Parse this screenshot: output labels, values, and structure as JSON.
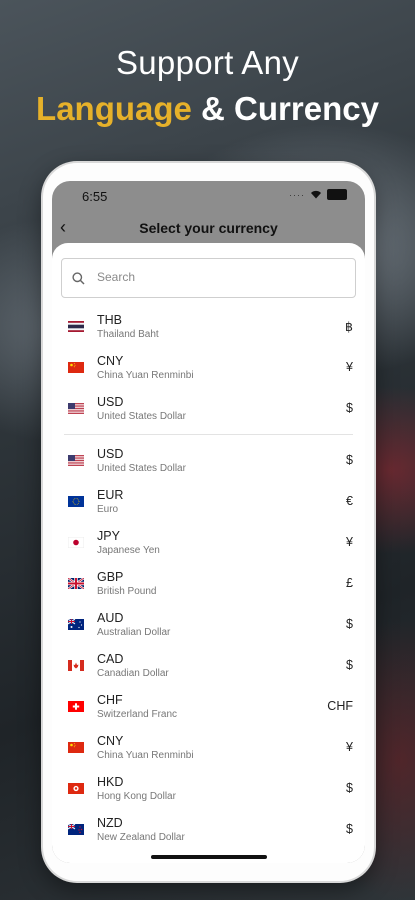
{
  "headline": {
    "line1": "Support Any",
    "line2_highlight": "Language",
    "line2_rest": " & Currency",
    "highlight_color": "#e6b12a"
  },
  "status_bar": {
    "time": "6:55"
  },
  "nav": {
    "title": "Select your currency",
    "back_icon": "chevron-left-icon"
  },
  "search": {
    "placeholder": "Search",
    "value": ""
  },
  "recent": [
    {
      "code": "THB",
      "name": "Thailand Baht",
      "symbol": "฿",
      "flag": "th"
    },
    {
      "code": "CNY",
      "name": "China Yuan Renminbi",
      "symbol": "¥",
      "flag": "cn"
    },
    {
      "code": "USD",
      "name": "United States Dollar",
      "symbol": "$",
      "flag": "us"
    }
  ],
  "currencies": [
    {
      "code": "USD",
      "name": "United States Dollar",
      "symbol": "$",
      "flag": "us"
    },
    {
      "code": "EUR",
      "name": "Euro",
      "symbol": "€",
      "flag": "eu"
    },
    {
      "code": "JPY",
      "name": "Japanese Yen",
      "symbol": "¥",
      "flag": "jp"
    },
    {
      "code": "GBP",
      "name": "British Pound",
      "symbol": "£",
      "flag": "gb"
    },
    {
      "code": "AUD",
      "name": "Australian Dollar",
      "symbol": "$",
      "flag": "au"
    },
    {
      "code": "CAD",
      "name": "Canadian Dollar",
      "symbol": "$",
      "flag": "ca"
    },
    {
      "code": "CHF",
      "name": "Switzerland Franc",
      "symbol": "CHF",
      "flag": "ch"
    },
    {
      "code": "CNY",
      "name": "China Yuan Renminbi",
      "symbol": "¥",
      "flag": "cn"
    },
    {
      "code": "HKD",
      "name": "Hong Kong Dollar",
      "symbol": "$",
      "flag": "hk"
    },
    {
      "code": "NZD",
      "name": "New Zealand Dollar",
      "symbol": "$",
      "flag": "nz"
    }
  ]
}
